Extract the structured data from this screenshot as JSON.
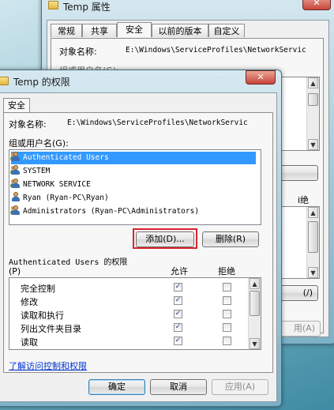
{
  "back_window": {
    "title": "Temp 属性",
    "tabs": [
      "常规",
      "共享",
      "安全",
      "以前的版本",
      "自定义"
    ],
    "object_label": "对象名称:",
    "object_value": "E:\\Windows\\ServiceProfiles\\NetworkServic",
    "group_label_partial": "组或用户名(G):",
    "peek_button": "用(A)",
    "peek_button_small": "(/)",
    "peek_text": "i绝"
  },
  "dialog": {
    "title": "Temp 的权限",
    "tab": "安全",
    "object_label": "对象名称:",
    "object_value": "E:\\Windows\\ServiceProfiles\\NetworkServic",
    "group_label": "组或用户名(G):",
    "users": [
      {
        "name": "Authenticated Users",
        "selected": true,
        "icon": "group-icon"
      },
      {
        "name": "SYSTEM",
        "selected": false,
        "icon": "group-icon"
      },
      {
        "name": "NETWORK SERVICE",
        "selected": false,
        "icon": "group-icon"
      },
      {
        "name": "Ryan (Ryan-PC\\Ryan)",
        "selected": false,
        "icon": "user-icon"
      },
      {
        "name": "Administrators (Ryan-PC\\Administrators)",
        "selected": false,
        "icon": "group-icon"
      }
    ],
    "add_button": "添加(D)...",
    "remove_button": "删除(R)",
    "perm_label_line1": "Authenticated Users 的权限",
    "perm_label_line2": "(P)",
    "allow_header": "允许",
    "deny_header": "拒绝",
    "permissions": [
      {
        "name": "完全控制",
        "allow": true,
        "deny": false
      },
      {
        "name": "修改",
        "allow": true,
        "deny": false
      },
      {
        "name": "读取和执行",
        "allow": true,
        "deny": false
      },
      {
        "name": "列出文件夹目录",
        "allow": true,
        "deny": false
      },
      {
        "name": "读取",
        "allow": true,
        "deny": false
      }
    ],
    "help_link": "了解访问控制和权限",
    "ok_button": "确定",
    "cancel_button": "取消",
    "apply_button": "应用(A)"
  },
  "colors": {
    "highlight": "#3399ff",
    "annotation_red": "#d9232e",
    "close_red": "#c8443a"
  }
}
